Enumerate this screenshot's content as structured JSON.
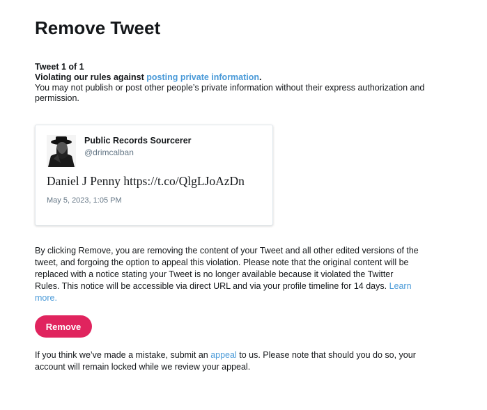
{
  "page_title": "Remove Tweet",
  "violation": {
    "count": "Tweet 1 of 1",
    "rule_prefix": "Violating our rules against ",
    "rule_link": "posting private information",
    "rule_suffix": ".",
    "description": "You may not publish or post other people’s private information without their express authorization and permission."
  },
  "tweet": {
    "author_name": "Public Records Sourcerer",
    "author_handle": "@drimcalban",
    "text": "Daniel J Penny https://t.co/QlgLJoAzDn",
    "timestamp": "May 5, 2023, 1:05 PM"
  },
  "removal_notice": {
    "text": "By clicking Remove, you are removing the content of your Tweet and all other edited versions of the tweet, and forgoing the option to appeal this violation. Please note that the original content will be replaced with a notice stating your Tweet is no longer available because it violated the Twitter Rules. This notice will be accessible via direct URL and via your profile timeline for 14 days. ",
    "learn_more": "Learn more."
  },
  "remove_button": "Remove",
  "appeal_notice": {
    "prefix": "If you think we’ve made a mistake, submit an ",
    "link": "appeal",
    "suffix": " to us. Please note that should you do so, your account will remain locked while we review your appeal."
  },
  "colors": {
    "accent_link": "#4a9ad8",
    "remove_button_bg": "#e0245e",
    "muted_text": "#657786"
  }
}
